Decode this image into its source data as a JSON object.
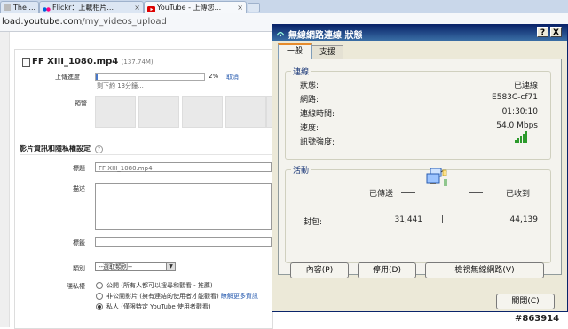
{
  "browser": {
    "tabs": [
      {
        "label": "The ...",
        "active": false
      },
      {
        "label": "Flickr：上載相片...",
        "active": false
      },
      {
        "label": "YouTube - 上傳您...",
        "active": true
      }
    ],
    "url_domain": "load.youtube.com",
    "url_path": "/my_videos_upload"
  },
  "upload": {
    "filename": "FF XIII_1080.mp4",
    "filesize": "(137.74M)",
    "progress_label": "上傳進度",
    "progress_percent": 2,
    "progress_percent_text": "2%",
    "cancel_label": "取消",
    "remaining_text": "剩下約 13分鐘...",
    "preview_label": "預覽",
    "section_title": "影片資訊和隱私權設定",
    "title_label": "標題",
    "title_value": "FF XIII_1080.mp4",
    "description_label": "描述",
    "tags_label": "標籤",
    "category_label": "類別",
    "category_value": "--選取類別--",
    "privacy_label": "隱私權",
    "privacy_options": [
      {
        "label": "公開 (所有人都可以搜尋和觀看 - 推薦)",
        "selected": false
      },
      {
        "label": "非公開影片 (擁有連結的使用者才能觀看)",
        "link": "瞭解更多資訊",
        "selected": false
      },
      {
        "label": "私人 (僅限特定 YouTube 使用者觀看)",
        "selected": true
      }
    ]
  },
  "dialog": {
    "title": "無線網路連線 狀態",
    "help_btn": "?",
    "close_btn": "X",
    "tabs": [
      "一般",
      "支援"
    ],
    "connection_group": "連線",
    "rows": [
      {
        "label": "狀態:",
        "value": "已連線"
      },
      {
        "label": "網路:",
        "value": "E583C-cf71"
      },
      {
        "label": "連線時間:",
        "value": "01:30:10"
      },
      {
        "label": "速度:",
        "value": "54.0 Mbps"
      },
      {
        "label": "訊號強度:",
        "value": ""
      }
    ],
    "activity_group": "活動",
    "sent_label": "已傳送",
    "received_label": "已收到",
    "packets_label": "封包:",
    "packets_sent": "31,441",
    "packets_received": "44,139",
    "buttons": {
      "properties": "內容(P)",
      "disable": "停用(D)",
      "view_networks": "檢視無線網路(V)",
      "close": "關閉(C)"
    },
    "signal_bars": 5
  },
  "watermark": "#863914"
}
